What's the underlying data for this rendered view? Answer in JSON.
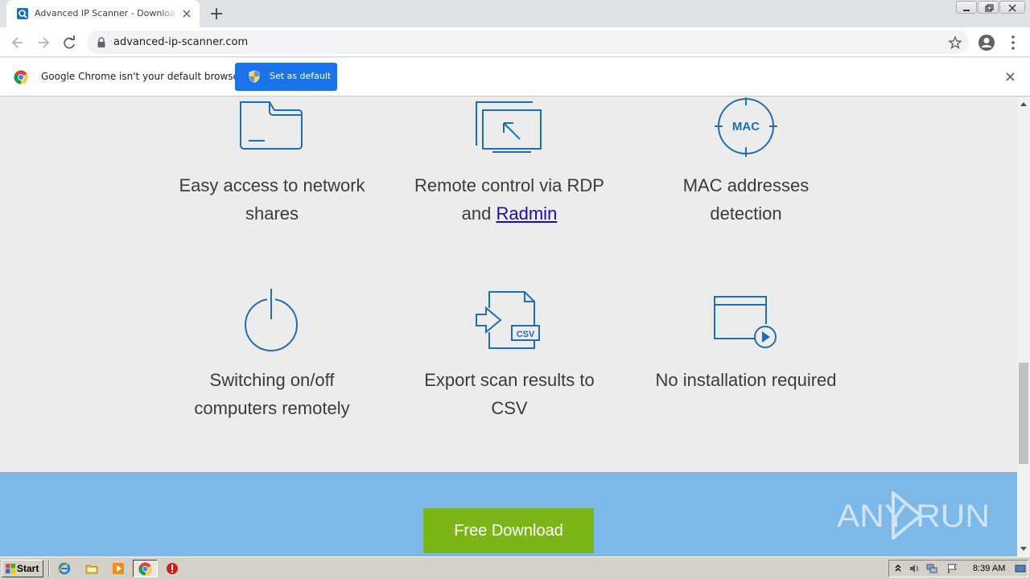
{
  "browser": {
    "tab_title": "Advanced IP Scanner - Download Free",
    "url": "advanced-ip-scanner.com"
  },
  "infobar": {
    "message": "Google Chrome isn't your default browser",
    "button_label": "Set as default"
  },
  "features": {
    "row1": [
      {
        "line1": "Easy access to network",
        "line2": "shares",
        "icon": "folder-icon"
      },
      {
        "line1": "Remote control via RDP",
        "line2_prefix": "and ",
        "line2_link": "Radmin",
        "icon": "remote-screen-icon"
      },
      {
        "line1": "MAC addresses",
        "line2": "detection",
        "icon": "mac-target-icon",
        "icon_text": "MAC"
      }
    ],
    "row2": [
      {
        "line1": "Switching on/off",
        "line2": "computers remotely",
        "icon": "power-icon"
      },
      {
        "line1": "Export scan results to",
        "line2": "CSV",
        "icon": "export-csv-icon",
        "icon_text": "CSV"
      },
      {
        "line1": "No installation required",
        "icon": "window-play-icon"
      }
    ]
  },
  "download": {
    "label": "Free Download"
  },
  "watermark": {
    "text": "ANY RUN"
  },
  "taskbar": {
    "start_label": "Start",
    "clock": "8:39 AM"
  },
  "colors": {
    "icon_blue": "#1d6fb3",
    "band_blue": "#7cb8e8",
    "download_green": "#7cb518",
    "chrome_blue": "#1a73e8"
  }
}
